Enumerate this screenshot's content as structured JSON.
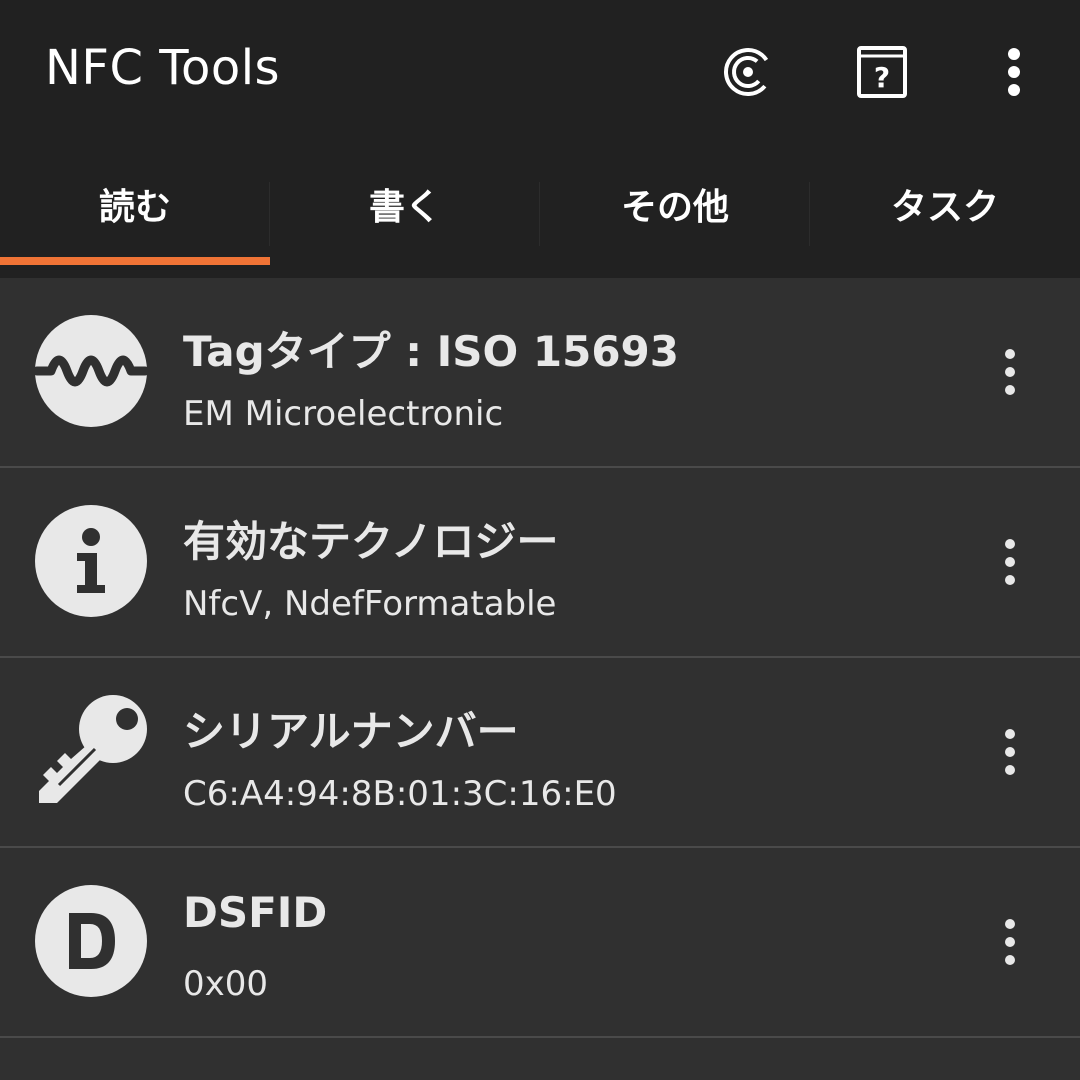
{
  "appbar": {
    "title": "NFC Tools",
    "icons": [
      "coin-icon",
      "help-book-icon",
      "overflow-menu-icon"
    ]
  },
  "tabs": [
    {
      "label": "読む",
      "selected": true
    },
    {
      "label": "書く",
      "selected": false
    },
    {
      "label": "その他",
      "selected": false
    },
    {
      "label": "タスク",
      "selected": false
    }
  ],
  "colors": {
    "accent": "#f07436",
    "appbar_bg": "#212121",
    "content_bg": "#303030",
    "icon_fill": "#e8e8e8"
  },
  "rows": [
    {
      "icon": "wave-icon",
      "title": "Tagタイプ : ISO 15693",
      "subtitle": "EM Microelectronic"
    },
    {
      "icon": "info-icon",
      "title": "有効なテクノロジー",
      "subtitle": "NfcV, NdefFormatable"
    },
    {
      "icon": "key-icon",
      "title": "シリアルナンバー",
      "subtitle": "C6:A4:94:8B:01:3C:16:E0"
    },
    {
      "icon": "letter-d-icon",
      "title": "DSFID",
      "subtitle": "0x00"
    }
  ]
}
